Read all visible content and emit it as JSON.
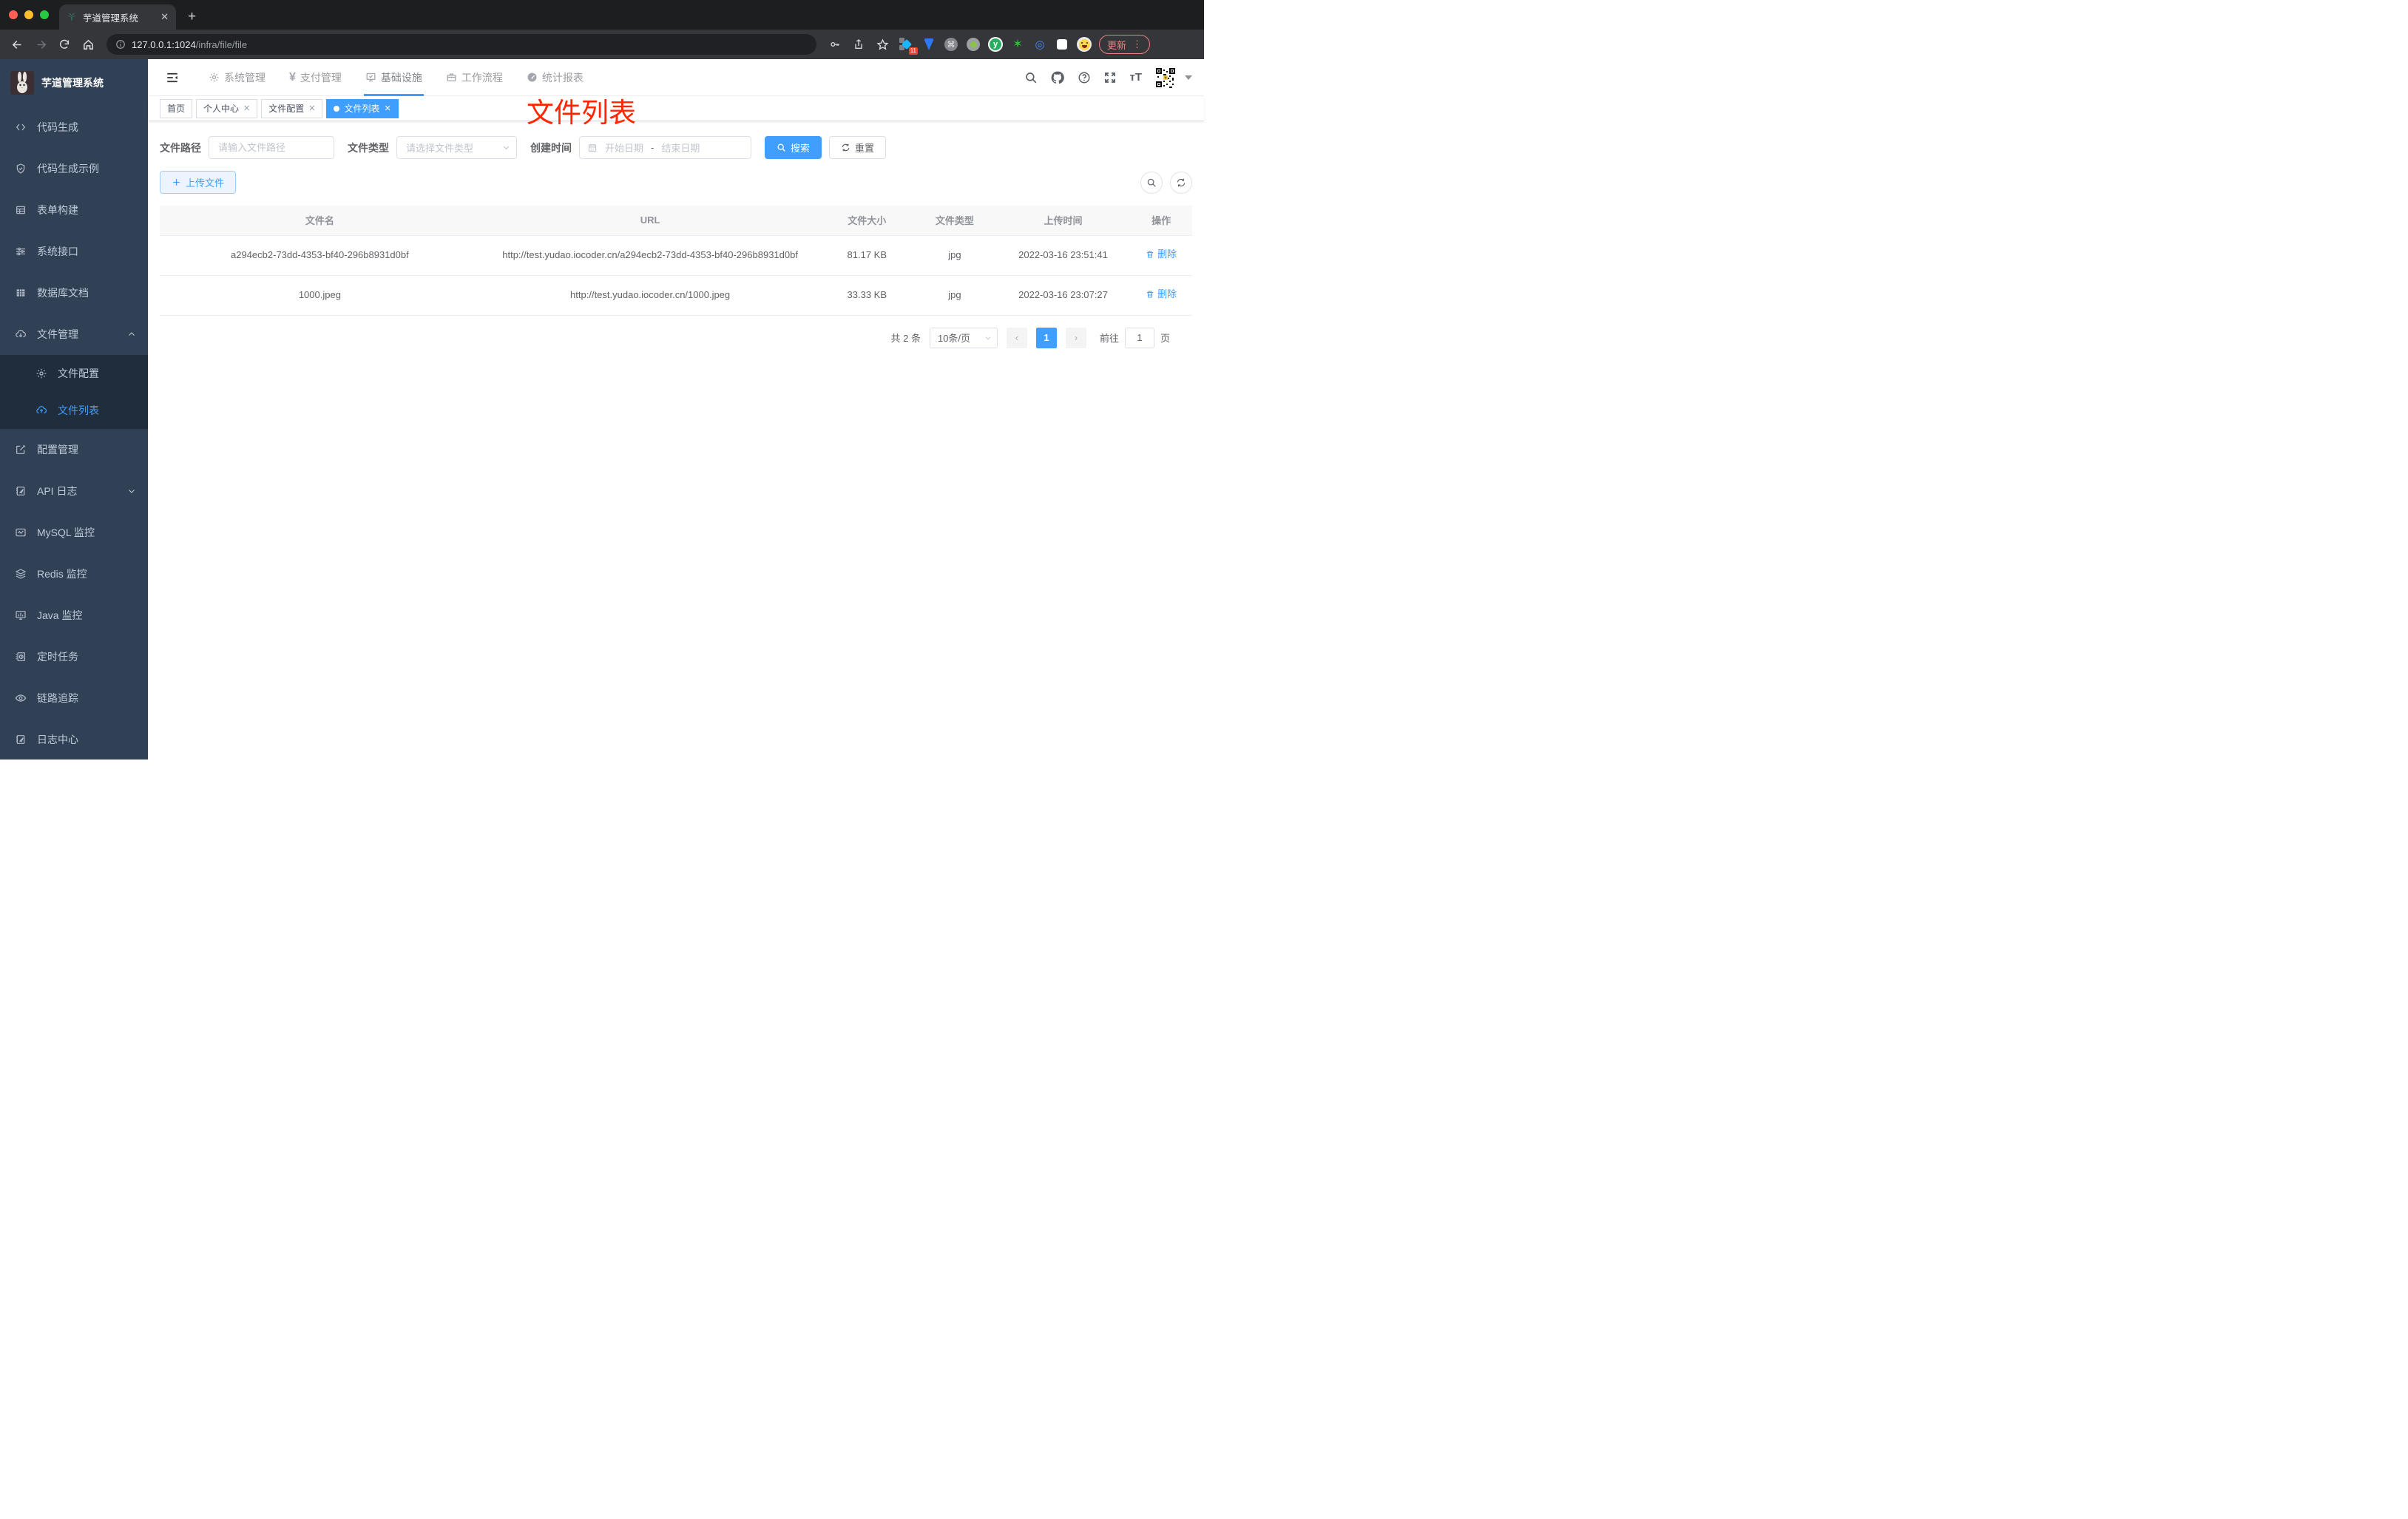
{
  "browser": {
    "tab_title": "芋道管理系统",
    "url_host": "127.0.0.1:1024",
    "url_path": "/infra/file/file",
    "extension_badge": "11",
    "update_label": "更新"
  },
  "sidebar": {
    "title": "芋道管理系统",
    "items": [
      {
        "label": "代码生成"
      },
      {
        "label": "代码生成示例"
      },
      {
        "label": "表单构建"
      },
      {
        "label": "系统接口"
      },
      {
        "label": "数据库文档"
      },
      {
        "label": "文件管理"
      },
      {
        "label": "文件配置"
      },
      {
        "label": "文件列表"
      },
      {
        "label": "配置管理"
      },
      {
        "label": "API 日志"
      },
      {
        "label": "MySQL 监控"
      },
      {
        "label": "Redis 监控"
      },
      {
        "label": "Java 监控"
      },
      {
        "label": "定时任务"
      },
      {
        "label": "链路追踪"
      },
      {
        "label": "日志中心"
      }
    ]
  },
  "topnav": {
    "items": [
      {
        "label": "系统管理"
      },
      {
        "label": "支付管理"
      },
      {
        "label": "基础设施"
      },
      {
        "label": "工作流程"
      },
      {
        "label": "统计报表"
      }
    ]
  },
  "tabs": [
    {
      "label": "首页"
    },
    {
      "label": "个人中心"
    },
    {
      "label": "文件配置"
    },
    {
      "label": "文件列表"
    }
  ],
  "annotation": "文件列表",
  "filters": {
    "path_label": "文件路径",
    "path_placeholder": "请输入文件路径",
    "type_label": "文件类型",
    "type_placeholder": "请选择文件类型",
    "time_label": "创建时间",
    "start_placeholder": "开始日期",
    "separator": "-",
    "end_placeholder": "结束日期",
    "search_label": "搜索",
    "reset_label": "重置"
  },
  "toolbar": {
    "upload_label": "上传文件"
  },
  "table": {
    "headers": [
      "文件名",
      "URL",
      "文件大小",
      "文件类型",
      "上传时间",
      "操作"
    ],
    "rows": [
      {
        "name": "a294ecb2-73dd-4353-bf40-296b8931d0bf",
        "url": "http://test.yudao.iocoder.cn/a294ecb2-73dd-4353-bf40-296b8931d0bf",
        "size": "81.17 KB",
        "type": "jpg",
        "time": "2022-03-16 23:51:41",
        "action": "删除"
      },
      {
        "name": "1000.jpeg",
        "url": "http://test.yudao.iocoder.cn/1000.jpeg",
        "size": "33.33 KB",
        "type": "jpg",
        "time": "2022-03-16 23:07:27",
        "action": "删除"
      }
    ]
  },
  "pagination": {
    "total": "共 2 条",
    "page_size": "10条/页",
    "current_page": "1",
    "jump_prefix": "前往",
    "jump_value": "1",
    "jump_suffix": "页"
  },
  "colors": {
    "accent": "#409eff",
    "annotation_red": "#ff2600",
    "sidebar_bg": "#304156",
    "submenu_bg": "#1f2d3d"
  }
}
